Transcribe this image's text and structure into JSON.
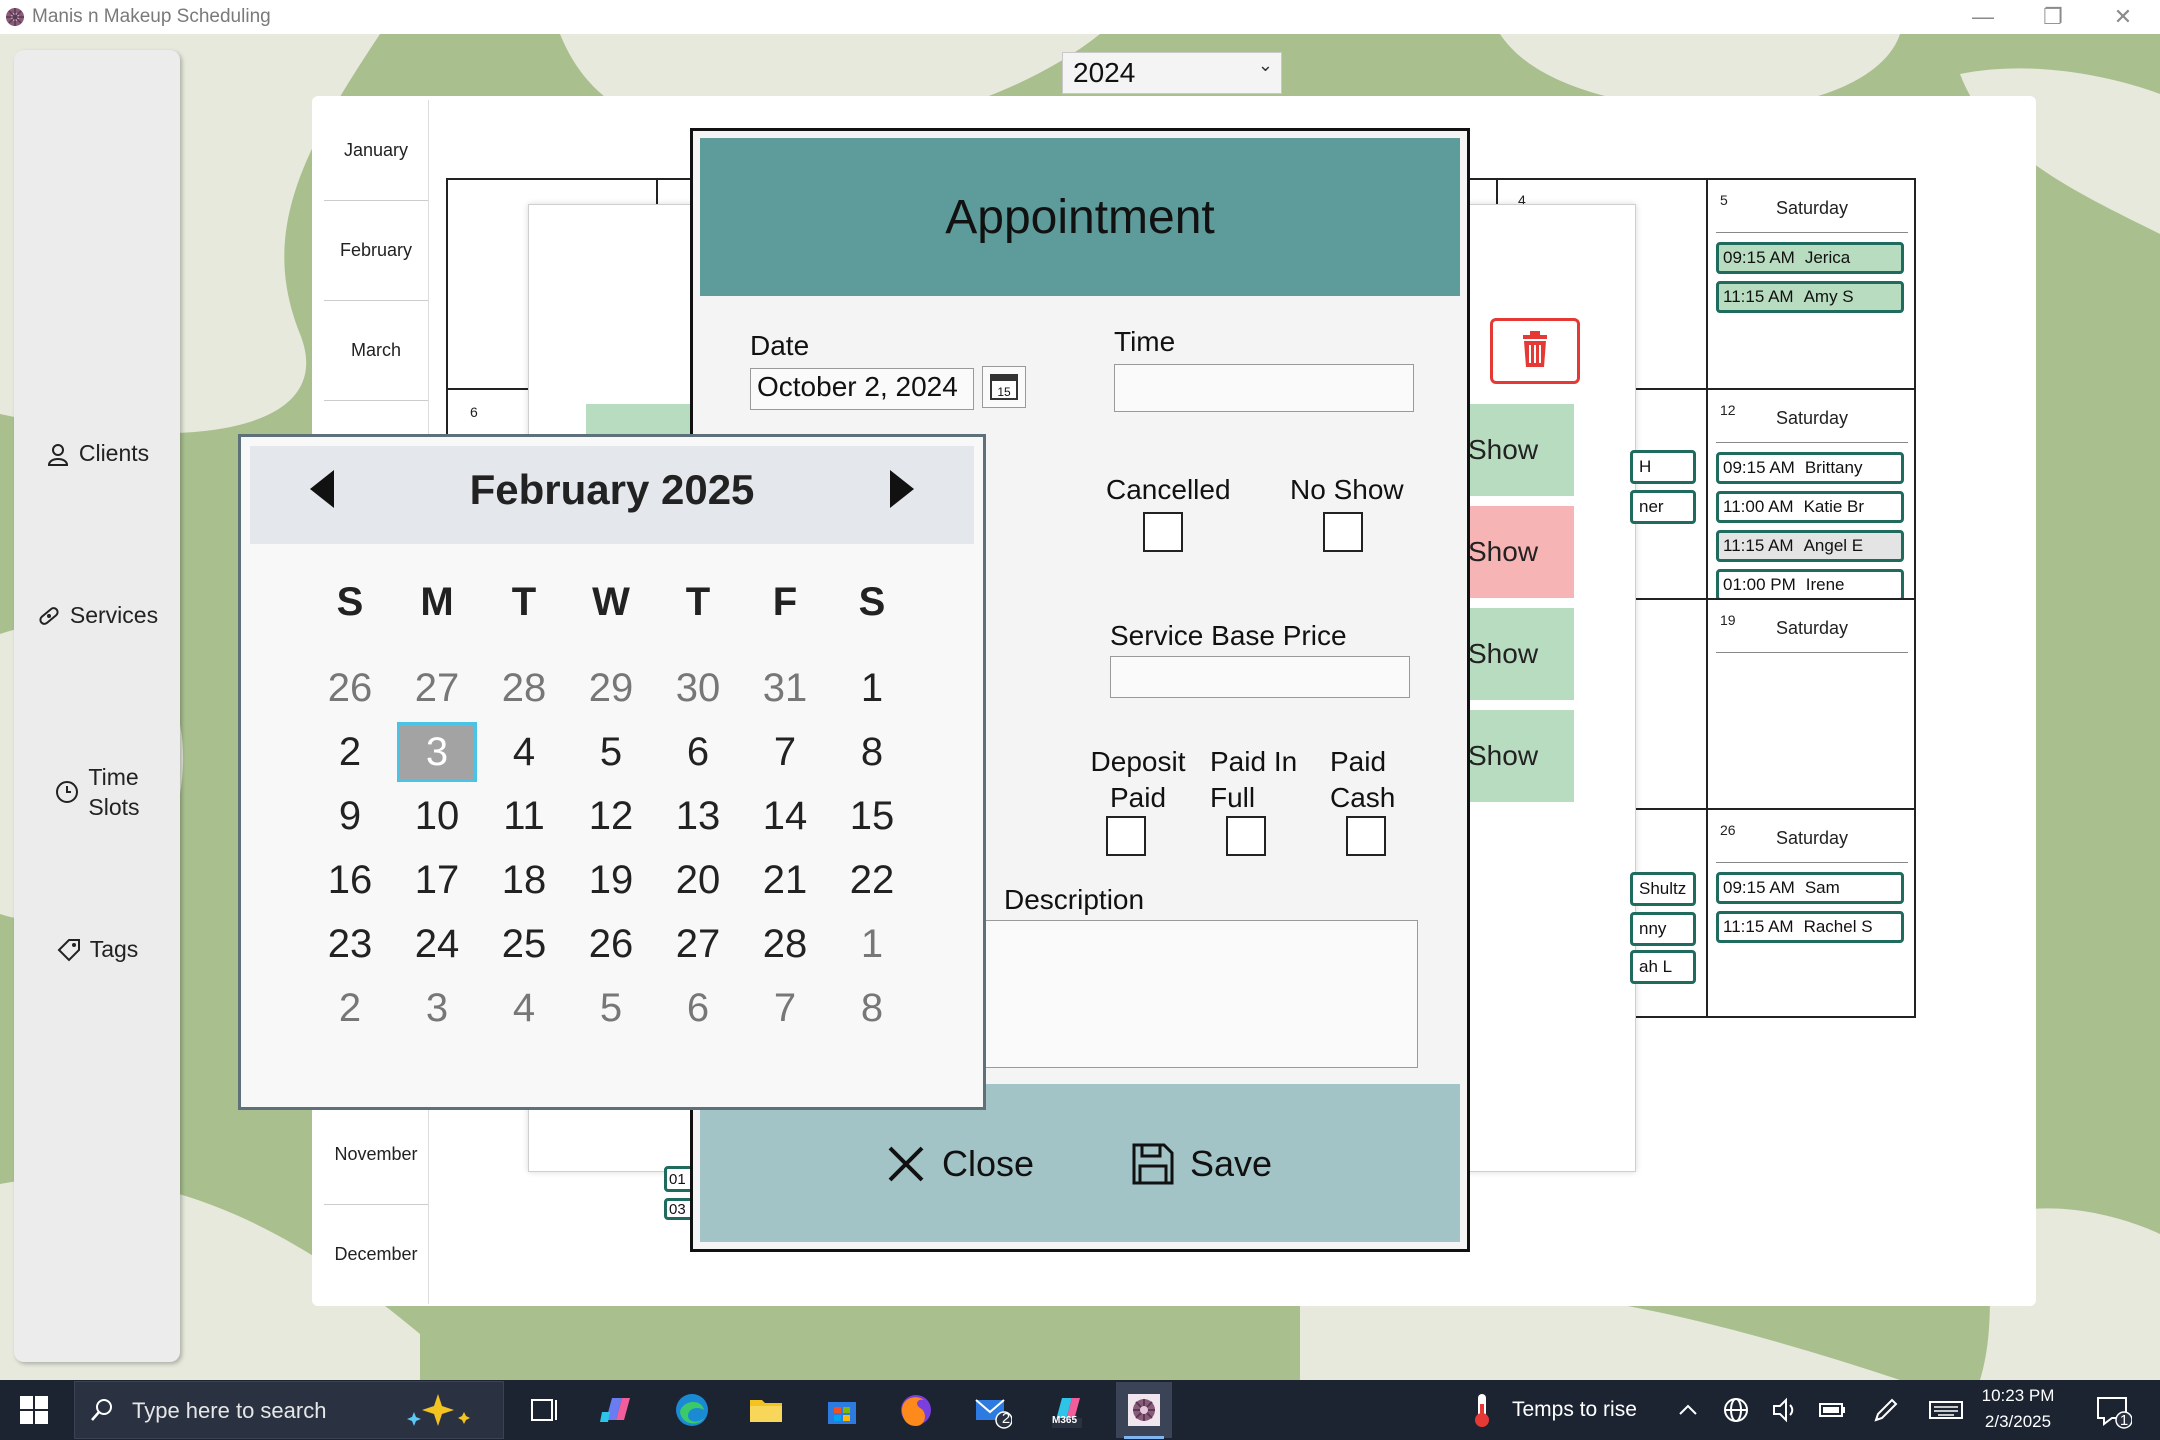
{
  "window": {
    "title": "Manis n Makeup Scheduling",
    "minimize": "—",
    "restore": "❐",
    "close": "✕"
  },
  "year_select": {
    "value": "2024",
    "caret": "⌄"
  },
  "sidebar": {
    "items": [
      {
        "label": "Clients",
        "icon": "person-icon"
      },
      {
        "label": "Services",
        "icon": "bandage-icon"
      },
      {
        "label": "Time\nSlots",
        "line1": "Time",
        "line2": "Slots",
        "icon": "clock-icon"
      },
      {
        "label": "Tags",
        "icon": "tag-icon"
      }
    ]
  },
  "months": [
    "January",
    "February",
    "March",
    "November",
    "December"
  ],
  "calendar": {
    "saturdays": [
      {
        "num": "5",
        "name": "Saturday",
        "appts": [
          {
            "time": "09:15 AM",
            "name": "Jerica",
            "style": "green"
          },
          {
            "time": "11:15 AM",
            "name": "Amy S",
            "style": "green"
          }
        ]
      },
      {
        "num": "12",
        "name": "Saturday",
        "appts": [
          {
            "time": "09:15 AM",
            "name": "Brittany",
            "style": "white"
          },
          {
            "time": "11:00 AM",
            "name": "Katie Br",
            "style": "white"
          },
          {
            "time": "11:15 AM",
            "name": "Angel E",
            "style": "grey"
          },
          {
            "time": "01:00 PM",
            "name": "Irene",
            "style": "white"
          }
        ]
      },
      {
        "num": "19",
        "name": "Saturday",
        "appts": []
      },
      {
        "num": "26",
        "name": "Saturday",
        "appts": [
          {
            "time": "09:15 AM",
            "name": "Sam",
            "style": "white"
          },
          {
            "time": "11:15 AM",
            "name": "Rachel S",
            "style": "white"
          }
        ]
      }
    ],
    "partial_cells": {
      "num6": "6",
      "num4": "4",
      "frag1": "H",
      "frag2": "ner",
      "frag3": "Shultz",
      "frag4": "nny",
      "frag5": "ah L",
      "frag6": "01",
      "frag7": "03"
    }
  },
  "background_list": {
    "show_labels": [
      "Show",
      "Show",
      "Show",
      "Show"
    ],
    "cancel_label": "Cancel",
    "no_label": "No"
  },
  "appointment": {
    "title": "Appointment",
    "date_label": "Date",
    "date_value": "October 2, 2024",
    "calendar_btn": "15",
    "time_label": "Time",
    "time_value": "",
    "cancelled_label": "Cancelled",
    "no_show_label": "No Show",
    "service_base_price_label": "Service Base Price",
    "service_base_price_value": "",
    "deposit_paid_label_1": "Deposit",
    "deposit_paid_label_2": "Paid",
    "paid_in_full_label_1": "Paid In",
    "paid_in_full_label_2": "Full",
    "paid_cash_label_1": "Paid",
    "paid_cash_label_2": "Cash",
    "description_label": "Description",
    "description_value": "",
    "close_label": "Close",
    "save_label": "Save"
  },
  "date_picker": {
    "title": "February 2025",
    "weekday_headers": [
      "S",
      "M",
      "T",
      "W",
      "T",
      "F",
      "S"
    ],
    "weeks": [
      [
        "26",
        "27",
        "28",
        "29",
        "30",
        "31",
        "1"
      ],
      [
        "2",
        "3",
        "4",
        "5",
        "6",
        "7",
        "8"
      ],
      [
        "9",
        "10",
        "11",
        "12",
        "13",
        "14",
        "15"
      ],
      [
        "16",
        "17",
        "18",
        "19",
        "20",
        "21",
        "22"
      ],
      [
        "23",
        "24",
        "25",
        "26",
        "27",
        "28",
        "1"
      ],
      [
        "2",
        "3",
        "4",
        "5",
        "6",
        "7",
        "8"
      ]
    ],
    "selected": "3"
  },
  "taskbar": {
    "search_placeholder": "Type here to search",
    "weather": "Temps to rise",
    "time": "10:23 PM",
    "date": "2/3/2025",
    "mail_badge": "2",
    "notification_badge": "1",
    "m365_label": "M365"
  },
  "colors": {
    "header_teal": "#5e9b9b",
    "footer_teal": "#a3c4c6",
    "bg_green": "#a9c08e",
    "appt_border": "#1f6b5e",
    "delete_red": "#e53935",
    "selected_border": "#49c3e6"
  }
}
